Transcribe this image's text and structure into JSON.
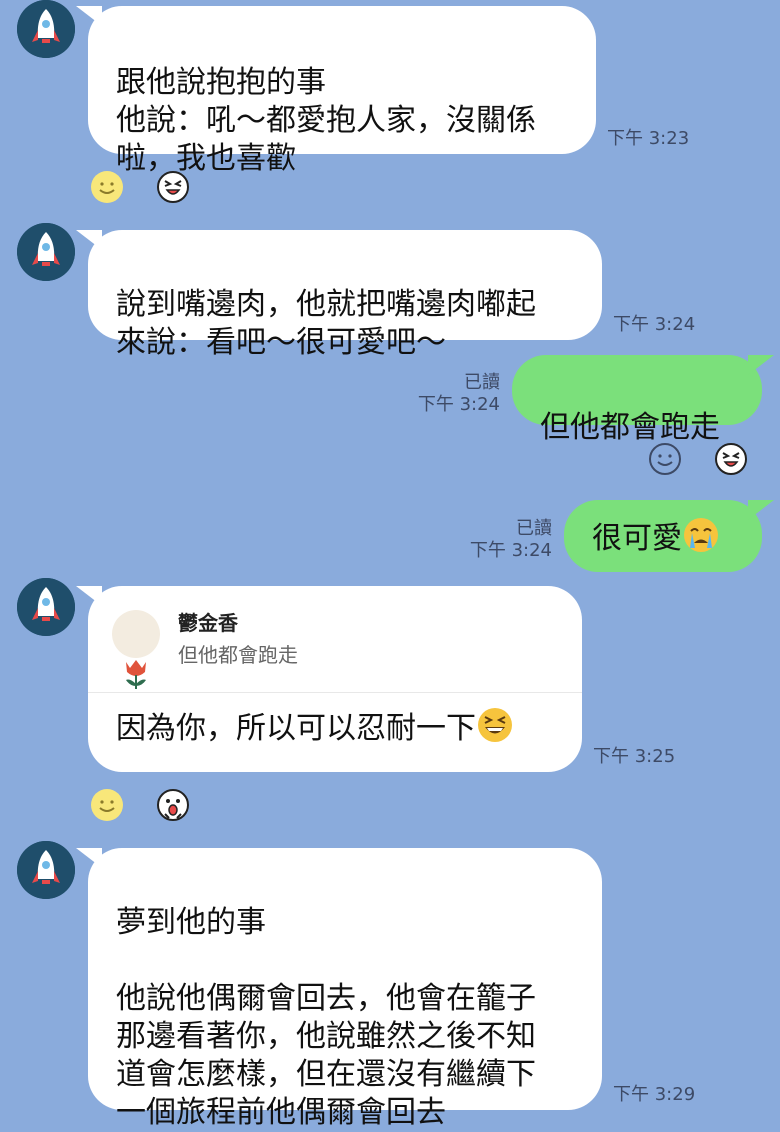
{
  "messages": [
    {
      "text": "跟他說抱抱的事\n他說：吼～都愛抱人家，沒關係\n啦，我也喜歡",
      "time": "下午 3:23",
      "reactions": [
        "smile-icon",
        "laughing-face-icon"
      ]
    },
    {
      "text": "說到嘴邊肉，他就把嘴邊肉嘟起\n來說：看吧～很可愛吧～",
      "time": "下午 3:24"
    },
    {
      "text": "但他都會跑走",
      "time": "下午 3:24",
      "read": "已讀",
      "reactions": [
        "smile-outline-icon",
        "laughing-face-icon"
      ]
    },
    {
      "text": "很可愛",
      "emoji": "crying-face-icon",
      "time": "下午 3:24",
      "read": "已讀"
    },
    {
      "quote_name": "鬱金香",
      "quote_text": "但他都會跑走",
      "text": "因為你，所以可以忍耐一下",
      "emoji": "grinning-squint-face-icon",
      "time": "下午 3:25",
      "reactions": [
        "smile-icon",
        "shocked-face-icon"
      ]
    },
    {
      "text": "夢到他的事\n\n他說他偶爾會回去，他會在籠子\n那邊看著你，他說雖然之後不知\n道會怎麼樣，但在還沒有繼續下\n一個旅程前他偶爾會回去",
      "time": "下午 3:29"
    }
  ],
  "colors": {
    "background": "#8aabdc",
    "incoming_bubble": "#ffffff",
    "outgoing_bubble": "#7be07b",
    "avatar": "#1f4e6b"
  }
}
